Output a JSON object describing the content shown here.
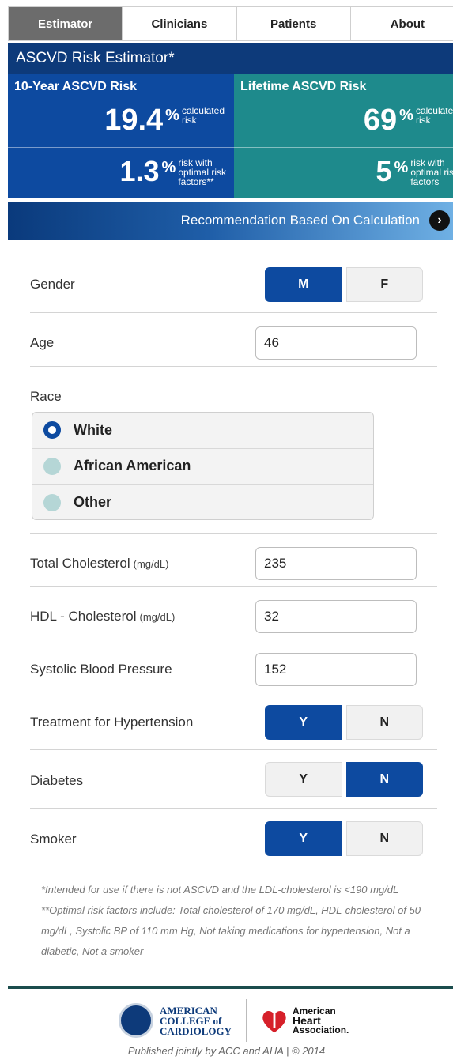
{
  "tabs": [
    {
      "label": "Estimator",
      "active": true
    },
    {
      "label": "Clinicians",
      "active": false
    },
    {
      "label": "Patients",
      "active": false
    },
    {
      "label": "About",
      "active": false
    }
  ],
  "title": "ASCVD Risk Estimator*",
  "ten_year": {
    "title": "10-Year ASCVD Risk",
    "calculated_value": "19.4",
    "calculated_caption_1": "calculated",
    "calculated_caption_2": "risk",
    "optimal_value": "1.3",
    "optimal_caption_1": "risk with",
    "optimal_caption_2": "optimal risk",
    "optimal_caption_3": "factors**"
  },
  "lifetime": {
    "title": "Lifetime ASCVD Risk",
    "calculated_value": "69",
    "calculated_caption_1": "calculated",
    "calculated_caption_2": "risk",
    "optimal_value": "5",
    "optimal_caption_1": "risk with",
    "optimal_caption_2": "optimal risk",
    "optimal_caption_3": "factors"
  },
  "percent_sign": "%",
  "recommendation_label": "Recommendation Based On Calculation",
  "form": {
    "gender": {
      "label": "Gender",
      "options": [
        "M",
        "F"
      ],
      "selected": "M"
    },
    "age": {
      "label": "Age",
      "value": "46"
    },
    "race": {
      "label": "Race",
      "options": [
        "White",
        "African American",
        "Other"
      ],
      "selected": "White"
    },
    "total_cholesterol": {
      "label": "Total Cholesterol",
      "unit": "(mg/dL)",
      "value": "235"
    },
    "hdl": {
      "label": "HDL - Cholesterol",
      "unit": "(mg/dL)",
      "value": "32"
    },
    "sbp": {
      "label": "Systolic Blood Pressure",
      "value": "152"
    },
    "hypertension": {
      "label": "Treatment for Hypertension",
      "options": [
        "Y",
        "N"
      ],
      "selected": "Y"
    },
    "diabetes": {
      "label": "Diabetes",
      "options": [
        "Y",
        "N"
      ],
      "selected": "N"
    },
    "smoker": {
      "label": "Smoker",
      "options": [
        "Y",
        "N"
      ],
      "selected": "Y"
    }
  },
  "footnote_1": "*Intended for use if there is not ASCVD and the LDL-cholesterol is <190 mg/dL",
  "footnote_2": "**Optimal risk factors include: Total cholesterol of 170 mg/dL, HDL-cholesterol of 50 mg/dL, Systolic BP of 110 mm Hg, Not taking medications for hypertension, Not a diabetic, Not a smoker",
  "acc_logo_text": [
    "AMERICAN",
    "COLLEGE of",
    "CARDIOLOGY"
  ],
  "aha_logo_text": [
    "American",
    "Heart",
    "Association."
  ],
  "published_line": "Published jointly by ACC and AHA | © 2014",
  "colors": {
    "primary_blue": "#0d4aa0",
    "teal": "#1e8a8c",
    "dark_blue": "#0d3a7a"
  }
}
